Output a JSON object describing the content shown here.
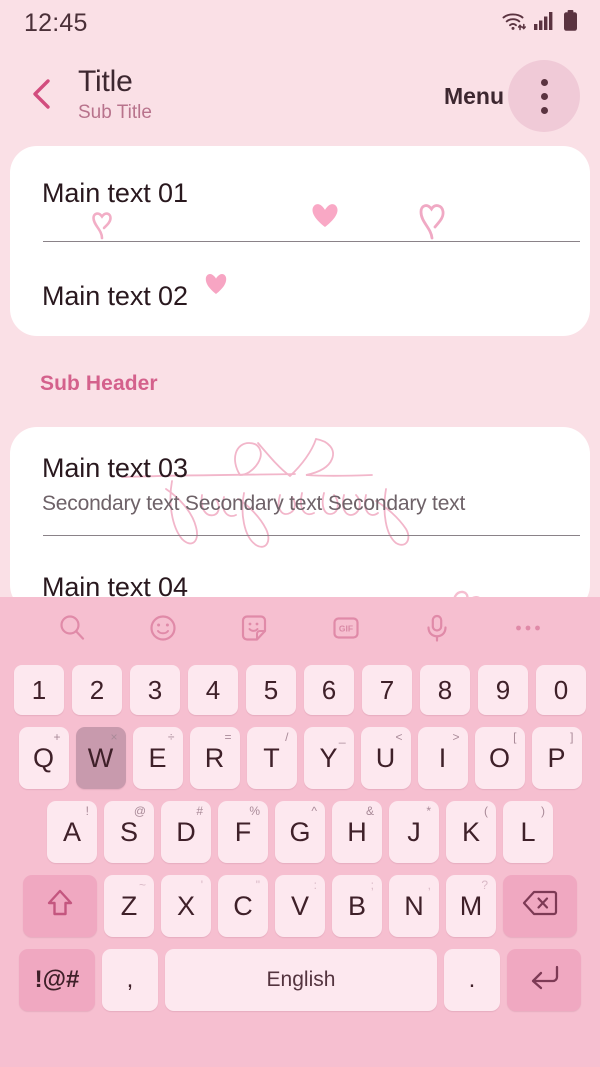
{
  "status_bar": {
    "time": "12:45",
    "icons": [
      "wifi-icon",
      "cellular-signal-icon",
      "battery-icon"
    ]
  },
  "app_bar": {
    "back_icon": "chevron-left-icon",
    "title": "Title",
    "subtitle": "Sub Title",
    "menu_label": "Menu",
    "overflow_icon": "more-vertical-icon"
  },
  "content": {
    "card_a": {
      "rows": [
        {
          "main": "Main text 01"
        },
        {
          "main": "Main text 02"
        }
      ]
    },
    "sub_header": "Sub Header",
    "card_b": {
      "rows": [
        {
          "main": "Main text 03",
          "secondary": "Secondary text Secondary text Secondary text"
        },
        {
          "main": "Main text 04"
        }
      ]
    }
  },
  "colors": {
    "background": "#fae0e6",
    "card": "#ffffff",
    "accent": "#d4618c",
    "keyboard_bg": "#f6bfd0",
    "key_bg": "#fde8ef",
    "key_fn_bg": "#f0a8c1",
    "key_pressed_bg": "#c89aad",
    "text_primary": "#29181e",
    "text_secondary": "#6e6268",
    "subtitle": "#b8738c"
  },
  "keyboard": {
    "toolbar": [
      {
        "name": "search-icon"
      },
      {
        "name": "emoji-icon"
      },
      {
        "name": "sticker-icon"
      },
      {
        "name": "gif-icon",
        "label": "GIF"
      },
      {
        "name": "microphone-icon"
      },
      {
        "name": "more-horizontal-icon"
      }
    ],
    "row_numbers": [
      "1",
      "2",
      "3",
      "4",
      "5",
      "6",
      "7",
      "8",
      "9",
      "0"
    ],
    "row_q": [
      {
        "key": "Q",
        "sup": "+"
      },
      {
        "key": "W",
        "sup": "×",
        "pressed": true
      },
      {
        "key": "E",
        "sup": "÷"
      },
      {
        "key": "R",
        "sup": "="
      },
      {
        "key": "T",
        "sup": "/"
      },
      {
        "key": "Y",
        "sup": "_"
      },
      {
        "key": "U",
        "sup": "<"
      },
      {
        "key": "I",
        "sup": ">"
      },
      {
        "key": "O",
        "sup": "["
      },
      {
        "key": "P",
        "sup": "]"
      }
    ],
    "row_a": [
      {
        "key": "A",
        "sup": "!"
      },
      {
        "key": "S",
        "sup": "@"
      },
      {
        "key": "D",
        "sup": "#"
      },
      {
        "key": "F",
        "sup": "%"
      },
      {
        "key": "G",
        "sup": "^"
      },
      {
        "key": "H",
        "sup": "&"
      },
      {
        "key": "J",
        "sup": "*"
      },
      {
        "key": "K",
        "sup": "("
      },
      {
        "key": "L",
        "sup": ")"
      }
    ],
    "row_z": [
      {
        "key": "Z",
        "sup": "~"
      },
      {
        "key": "X",
        "sup": "'"
      },
      {
        "key": "C",
        "sup": "\""
      },
      {
        "key": "V",
        "sup": ":"
      },
      {
        "key": "B",
        "sup": ";"
      },
      {
        "key": "N",
        "sup": ","
      },
      {
        "key": "M",
        "sup": "?"
      }
    ],
    "shift_icon": "shift-arrow-icon",
    "backspace_icon": "backspace-icon",
    "symbols_label": "!@#",
    "comma_label": ",",
    "space_label": "English",
    "period_label": ".",
    "enter_icon": "enter-return-icon"
  }
}
